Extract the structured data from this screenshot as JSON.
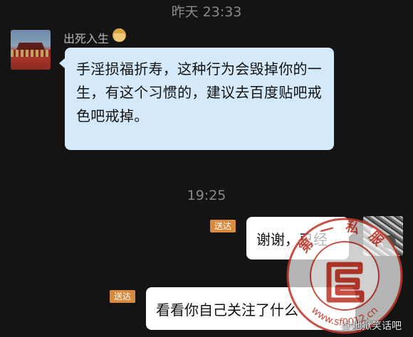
{
  "timestamps": {
    "first": "昨天 23:33",
    "second": "19:25"
  },
  "incoming": {
    "sender_name": "出死入生",
    "message": "手淫损福折寿，这种行为会毁掉你的一生，有这个习惯的，建议去百度贴吧戒色吧戒掉。"
  },
  "outgoing": [
    {
      "badge": "送达",
      "message": "谢谢，已经"
    },
    {
      "badge": "送达",
      "message": "看看你自己关注了什么"
    }
  ],
  "watermark": {
    "ring_text": "第一私服",
    "url_text": "www.sf0012.cn"
  },
  "corner_tag": "@地狱笑话吧",
  "colors": {
    "background": "#141414",
    "incoming_bubble": "#d4e9f9",
    "outgoing_bubble": "#ffffff",
    "badge": "#d98a3e",
    "watermark": "#c0392b"
  },
  "icons": {
    "sender_emoji": "baby-face-emoji"
  }
}
